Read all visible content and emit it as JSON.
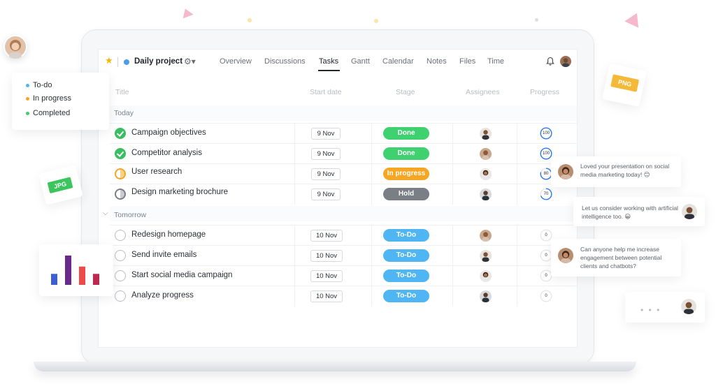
{
  "project": {
    "title": "Daily project",
    "color": "#4a9cf0"
  },
  "nav": {
    "tabs": [
      "Overview",
      "Discussions",
      "Tasks",
      "Gantt",
      "Calendar",
      "Notes",
      "Files",
      "Time"
    ],
    "active": "Tasks"
  },
  "table": {
    "headers": {
      "title": "Title",
      "start_date": "Start date",
      "stage": "Stage",
      "assignees": "Assignees",
      "progress": "Progress"
    },
    "sections": [
      {
        "label": "Today",
        "rows": [
          {
            "title": "Campaign objectives",
            "status": "done",
            "date": "9 Nov",
            "stage": "Done",
            "progress": "100"
          },
          {
            "title": "Competitor analysis",
            "status": "done",
            "date": "9 Nov",
            "stage": "Done",
            "progress": "100"
          },
          {
            "title": "User research",
            "status": "progress",
            "date": "9 Nov",
            "stage": "In progress",
            "progress": "80"
          },
          {
            "title": "Design marketing brochure",
            "status": "hold",
            "date": "9 Nov",
            "stage": "Hold",
            "progress": "70"
          }
        ]
      },
      {
        "label": "Tomorrow",
        "rows": [
          {
            "title": "Redesign homepage",
            "status": "todo",
            "date": "10 Nov",
            "stage": "To-Do",
            "progress": "0"
          },
          {
            "title": "Send invite emails",
            "status": "todo",
            "date": "10 Nov",
            "stage": "To-Do",
            "progress": "0"
          },
          {
            "title": "Start social media campaign",
            "status": "todo",
            "date": "10 Nov",
            "stage": "To-Do",
            "progress": "0"
          },
          {
            "title": "Analyze progress",
            "status": "todo",
            "date": "10 Nov",
            "stage": "To-Do",
            "progress": "0"
          }
        ]
      }
    ]
  },
  "legend": {
    "items": [
      {
        "label": "To-do",
        "color": "#4fb6f3"
      },
      {
        "label": "In progress",
        "color": "#f5a623"
      },
      {
        "label": "Completed",
        "color": "#3fd070"
      }
    ]
  },
  "badges": {
    "jpg": "JPG",
    "png": "PNG"
  },
  "chats": [
    {
      "text": "Loved your presentation on social media marketing today! 😊"
    },
    {
      "text": "Let us consider working with artificial intelligence too. 😀"
    },
    {
      "text": "Can anyone help me increase engagement between potential clients and chatbots?"
    }
  ],
  "mini_chart": {
    "values": [
      3,
      8,
      5,
      3
    ],
    "colors": [
      "#3d5fd0",
      "#6a2a8c",
      "#ef4a4a",
      "#c0294f"
    ]
  },
  "icons": {
    "star": "star-icon",
    "gear": "gear-icon",
    "bell": "bell-icon"
  }
}
